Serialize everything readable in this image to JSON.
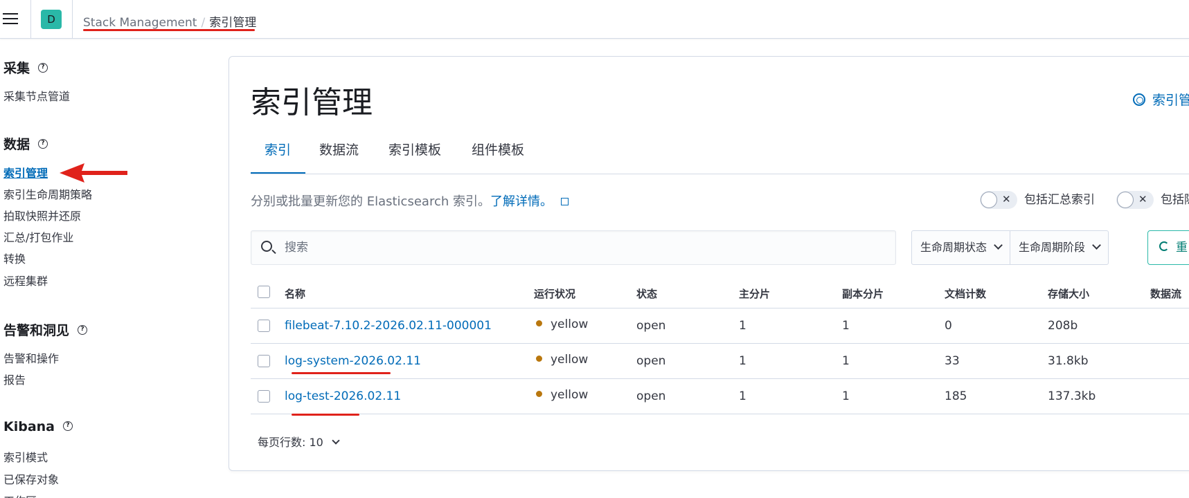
{
  "header": {
    "avatar_letter": "D",
    "breadcrumb_root": "Stack Management",
    "breadcrumb_separator": "/",
    "breadcrumb_current": "索引管理"
  },
  "sidebar": {
    "groups": [
      {
        "title": "采集",
        "items": [
          "采集节点管道"
        ]
      },
      {
        "title": "数据",
        "items": [
          "索引管理",
          "索引生命周期策略",
          "拍取快照并还原",
          "汇总/打包作业",
          "转换",
          "远程集群"
        ]
      },
      {
        "title": "告警和洞见",
        "items": [
          "告警和操作",
          "报告"
        ]
      },
      {
        "title": "Kibana",
        "items": [
          "索引模式",
          "已保存对象",
          "工作区"
        ]
      }
    ],
    "active_item": "索引管理",
    "help_glyph": "?"
  },
  "main": {
    "title": "索引管理",
    "help_link": "索引管",
    "tabs": [
      "索引",
      "数据流",
      "索引模板",
      "组件模板"
    ],
    "active_tab": "索引",
    "description": "分别或批量更新您的 Elasticsearch 索引。",
    "learn_more": "了解详情。",
    "toggles": [
      {
        "label": "包括汇总索引",
        "on": false
      },
      {
        "label": "包括隐",
        "on": false
      }
    ],
    "toggle_off_glyph": "✕",
    "search_placeholder": "搜索",
    "filters": [
      "生命周期状态",
      "生命周期阶段"
    ],
    "reload_label": "重"
  },
  "table": {
    "columns": [
      "名称",
      "运行状况",
      "状态",
      "主分片",
      "副本分片",
      "文档计数",
      "存储大小",
      "数据流"
    ],
    "rows": [
      {
        "name": "filebeat-7.10.2-2026.02.11-000001",
        "health": "yellow",
        "status": "open",
        "primary": "1",
        "replicas": "1",
        "docs": "0",
        "size": "208b",
        "stream": ""
      },
      {
        "name": "log-system-2026.02.11",
        "health": "yellow",
        "status": "open",
        "primary": "1",
        "replicas": "1",
        "docs": "33",
        "size": "31.8kb",
        "stream": ""
      },
      {
        "name": "log-test-2026.02.11",
        "health": "yellow",
        "status": "open",
        "primary": "1",
        "replicas": "1",
        "docs": "185",
        "size": "137.3kb",
        "stream": ""
      }
    ],
    "health_color": "#b9770e",
    "rows_per_page": "每页行数: 10"
  },
  "annotations": {
    "color": "#e0221b"
  }
}
